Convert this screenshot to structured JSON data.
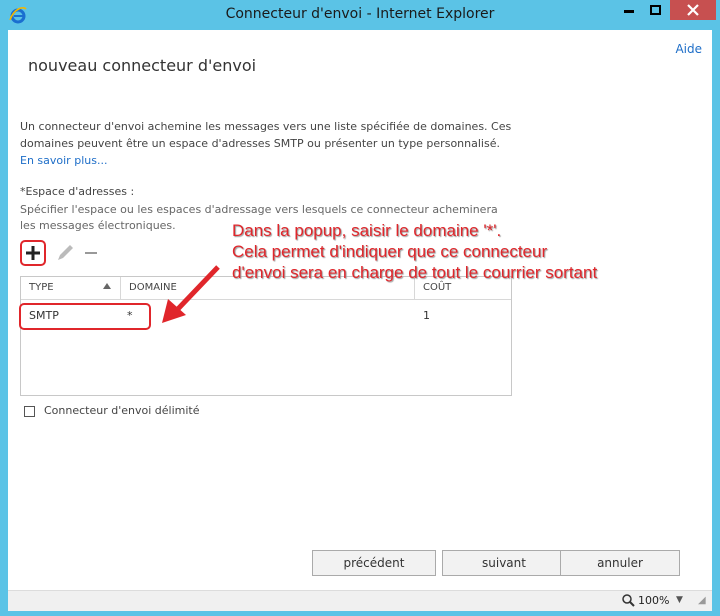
{
  "window": {
    "title": "Connecteur d'envoi - Internet Explorer"
  },
  "header": {
    "help_label": "Aide",
    "page_title": "nouveau connecteur d'envoi"
  },
  "description": {
    "text": "Un connecteur d'envoi achemine les messages vers une liste spécifiée de domaines. Ces domaines peuvent être un espace d'adresses SMTP ou présenter un type personnalisé. ",
    "link": "En savoir plus..."
  },
  "address_space": {
    "label": "*Espace d'adresses :",
    "description": "Spécifier l'espace ou les espaces d'adressage vers lesquels ce connecteur acheminera les messages électroniques."
  },
  "toolbar": {
    "add_icon": "plus-icon",
    "edit_icon": "pencil-icon",
    "remove_icon": "minus-icon"
  },
  "table": {
    "columns": [
      "TYPE",
      "DOMAINE",
      "COÛT"
    ],
    "rows": [
      {
        "type": "SMTP",
        "domain": "*",
        "cost": "1"
      }
    ]
  },
  "scoped": {
    "label": "Connecteur d'envoi délimité",
    "checked": false
  },
  "annotation": {
    "line1": "Dans la popup, saisir le domaine '*'.",
    "line2": "Cela permet d'indiquer que ce connecteur",
    "line3": "d'envoi sera en charge de tout le courrier sortant"
  },
  "buttons": {
    "prev": "précédent",
    "next": "suivant",
    "cancel": "annuler"
  },
  "status": {
    "zoom": "100%"
  },
  "colors": {
    "titlebar": "#5bc3e6",
    "accent_link": "#1e6ec8",
    "annotation": "#e0262b",
    "close_button": "#c75050"
  }
}
